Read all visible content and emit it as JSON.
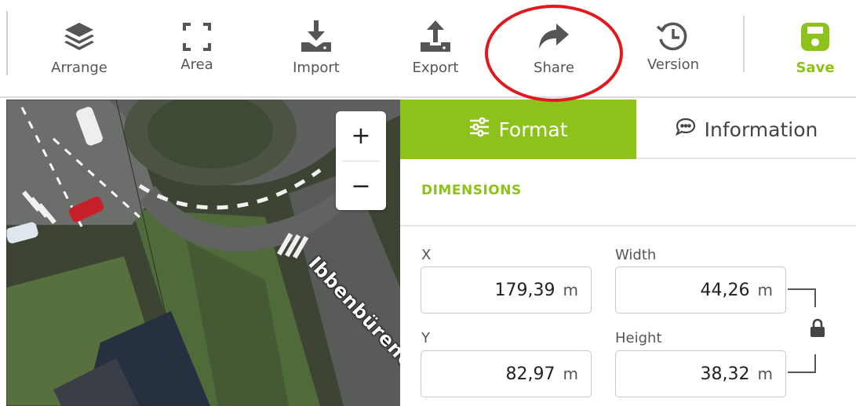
{
  "toolbar": {
    "items": [
      {
        "label": "Arrange",
        "icon": "layers-icon"
      },
      {
        "label": "Area",
        "icon": "area-select-icon"
      },
      {
        "label": "Import",
        "icon": "download-icon"
      },
      {
        "label": "Export",
        "icon": "upload-icon"
      },
      {
        "label": "Share",
        "icon": "share-arrow-icon"
      },
      {
        "label": "Version",
        "icon": "history-icon"
      },
      {
        "label": "Save",
        "icon": "save-disk-icon"
      }
    ]
  },
  "map": {
    "street_label": "Ibbenbürener",
    "zoom_in": "+",
    "zoom_out": "−"
  },
  "panel": {
    "tabs": [
      {
        "label": "Format",
        "icon": "sliders-icon",
        "active": true
      },
      {
        "label": "Information",
        "icon": "speech-bubble-icon",
        "active": false
      }
    ],
    "section_title": "DIMENSIONS",
    "fields": {
      "x": {
        "label": "X",
        "value": "179,39",
        "unit": "m"
      },
      "width": {
        "label": "Width",
        "value": "44,26",
        "unit": "m"
      },
      "y": {
        "label": "Y",
        "value": "82,97",
        "unit": "m"
      },
      "height": {
        "label": "Height",
        "value": "38,32",
        "unit": "m"
      }
    }
  },
  "colors": {
    "accent": "#8cc21a",
    "annotation": "#e0191e",
    "icon": "#555555"
  }
}
